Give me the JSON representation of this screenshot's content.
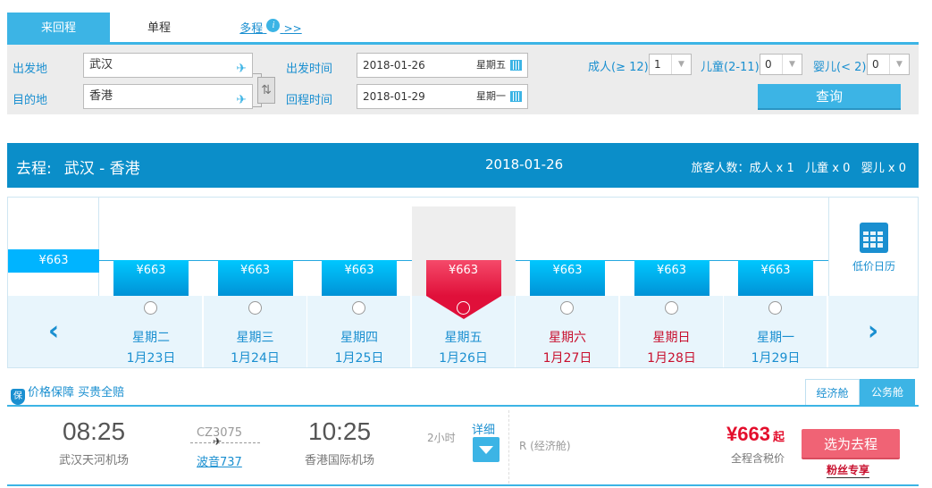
{
  "tabs": {
    "round": "来回程",
    "one_way": "单程",
    "multi": "多程",
    "multi_info": "i",
    "multi_more": ">>"
  },
  "search": {
    "from_label": "出发地",
    "to_label": "目的地",
    "from_value": "武汉",
    "to_value": "香港",
    "depart_label": "出发时间",
    "return_label": "回程时间",
    "depart_date": "2018-01-26",
    "depart_weekday": "星期五",
    "return_date": "2018-01-29",
    "return_weekday": "星期一",
    "adult_label": "成人(≥ 12)",
    "adult_value": "1",
    "child_label": "儿童(2-11)",
    "child_value": "0",
    "infant_label": "婴儿(< 2)",
    "infant_value": "0",
    "query_button": "查询"
  },
  "route": {
    "prefix": "去程:",
    "cities": "武汉 - 香港",
    "date": "2018-01-26",
    "pax": "旅客人数：成人 x 1   儿童 x 0   婴儿 x 0"
  },
  "calendar": {
    "min_price": "¥663",
    "low_price_label": "低价日历",
    "days": [
      {
        "price": "¥663",
        "weekday": "星期二",
        "date": "1月23日",
        "weekend": false,
        "selected": false
      },
      {
        "price": "¥663",
        "weekday": "星期三",
        "date": "1月24日",
        "weekend": false,
        "selected": false
      },
      {
        "price": "¥663",
        "weekday": "星期四",
        "date": "1月25日",
        "weekend": false,
        "selected": false
      },
      {
        "price": "¥663",
        "weekday": "星期五",
        "date": "1月26日",
        "weekend": false,
        "selected": true
      },
      {
        "price": "¥663",
        "weekday": "星期六",
        "date": "1月27日",
        "weekend": true,
        "selected": false
      },
      {
        "price": "¥663",
        "weekday": "星期日",
        "date": "1月28日",
        "weekend": true,
        "selected": false
      },
      {
        "price": "¥663",
        "weekday": "星期一",
        "date": "1月29日",
        "weekend": false,
        "selected": false
      }
    ]
  },
  "guarantee": {
    "icon_text": "保",
    "text": "价格保障 买贵全赔"
  },
  "cabin_tabs": {
    "economy": "经济舱",
    "business": "公务舱"
  },
  "flight": {
    "dep_time": "08:25",
    "dep_airport": "武汉天河机场",
    "flight_no": "CZ3075",
    "aircraft": "波音737",
    "arr_time": "10:25",
    "arr_airport": "香港国际机场",
    "duration": "2小时",
    "detail": "详细",
    "cabin": "R (经济舱)",
    "price": "¥663",
    "price_suffix": "起",
    "tax_note": "全程含税价",
    "choose_button": "选为去程",
    "fans": "粉丝专享"
  },
  "colors": {
    "accent": "#3cb4e5",
    "header": "#0b8ec9",
    "price_red": "#e30e2c",
    "weekend": "#c8102e"
  }
}
